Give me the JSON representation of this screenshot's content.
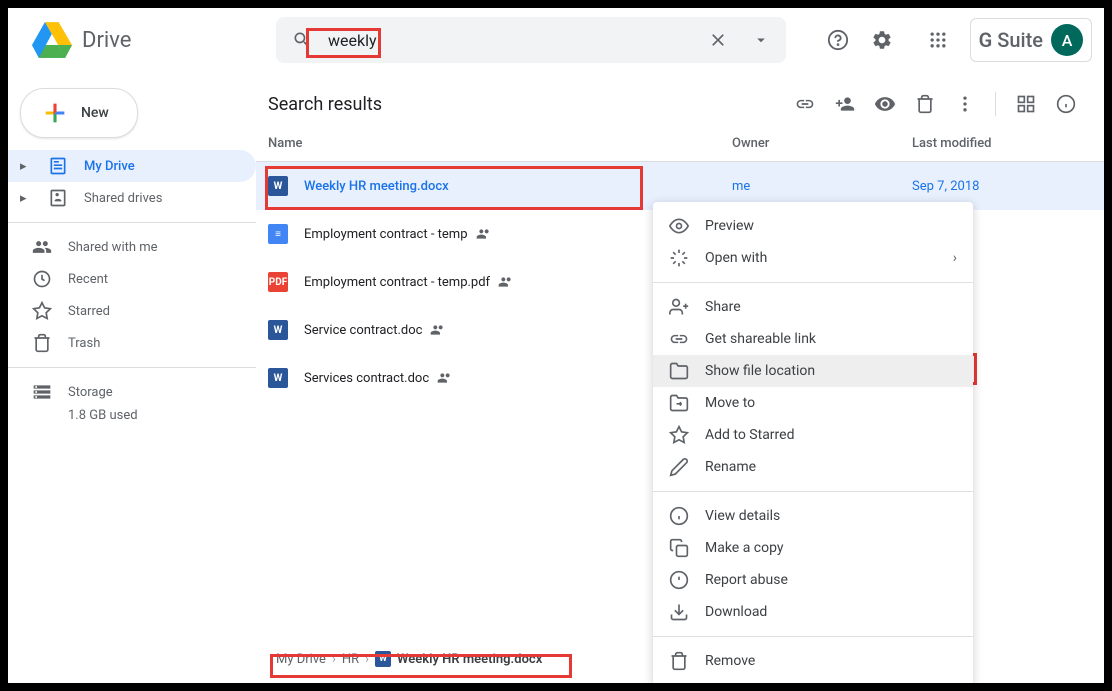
{
  "header": {
    "app_name": "Drive",
    "search_value": "weekly",
    "gsuite_label": "G Suite",
    "avatar_initial": "A"
  },
  "sidebar": {
    "new_label": "New",
    "items": [
      {
        "label": "My Drive",
        "icon": "my-drive-icon",
        "expandable": true,
        "active": true
      },
      {
        "label": "Shared drives",
        "icon": "shared-drives-icon",
        "expandable": true,
        "active": false
      }
    ],
    "secondary": [
      {
        "label": "Shared with me",
        "icon": "shared-with-me-icon"
      },
      {
        "label": "Recent",
        "icon": "recent-icon"
      },
      {
        "label": "Starred",
        "icon": "starred-icon"
      },
      {
        "label": "Trash",
        "icon": "trash-icon"
      }
    ],
    "storage_label": "Storage",
    "storage_used": "1.8 GB used"
  },
  "main": {
    "title": "Search results",
    "columns": {
      "name": "Name",
      "owner": "Owner",
      "modified": "Last modified"
    },
    "files": [
      {
        "name": "Weekly HR meeting.docx",
        "type": "word",
        "shared": false,
        "owner": "me",
        "modified": "Sep 7, 2018",
        "selected": true
      },
      {
        "name": "Employment contract - temp",
        "type": "gdoc",
        "shared": true,
        "owner": "",
        "modified": "",
        "selected": false
      },
      {
        "name": "Employment contract - temp.pdf",
        "type": "pdf",
        "shared": true,
        "owner": "",
        "modified": "",
        "selected": false
      },
      {
        "name": "Service contract.doc",
        "type": "word",
        "shared": true,
        "owner": "",
        "modified": "",
        "selected": false
      },
      {
        "name": "Services contract.doc",
        "type": "word",
        "shared": true,
        "owner": "",
        "modified": "",
        "selected": false
      }
    ]
  },
  "context_menu": {
    "items": [
      {
        "label": "Preview",
        "icon": "eye-icon"
      },
      {
        "label": "Open with",
        "icon": "open-with-icon",
        "caret": true
      },
      {
        "divider": true
      },
      {
        "label": "Share",
        "icon": "person-add-icon"
      },
      {
        "label": "Get shareable link",
        "icon": "link-icon"
      },
      {
        "label": "Show file location",
        "icon": "folder-icon",
        "hover": true
      },
      {
        "label": "Move to",
        "icon": "move-icon"
      },
      {
        "label": "Add to Starred",
        "icon": "star-icon"
      },
      {
        "label": "Rename",
        "icon": "rename-icon"
      },
      {
        "divider": true
      },
      {
        "label": "View details",
        "icon": "info-icon"
      },
      {
        "label": "Make a copy",
        "icon": "copy-icon"
      },
      {
        "label": "Report abuse",
        "icon": "report-icon"
      },
      {
        "label": "Download",
        "icon": "download-icon"
      },
      {
        "divider": true
      },
      {
        "label": "Remove",
        "icon": "trash-icon"
      }
    ]
  },
  "breadcrumb": {
    "parts": [
      "My Drive",
      "HR",
      "Weekly HR meeting.docx"
    ]
  }
}
